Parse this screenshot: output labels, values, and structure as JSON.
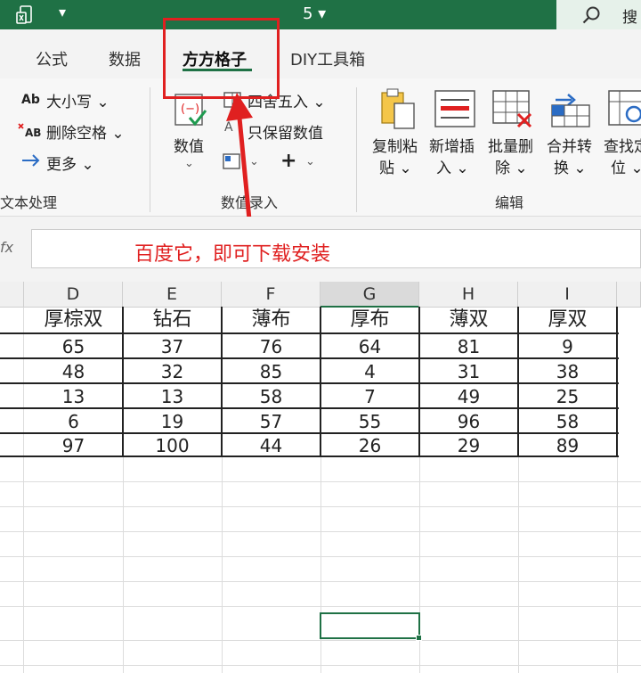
{
  "titlebar": {
    "title": "5 ▾",
    "quick_access_caret": "▾",
    "search_text": "搜"
  },
  "tabs": [
    "公式",
    "数据",
    "方方格子",
    "DIY工具箱"
  ],
  "active_tab": "方方格子",
  "ribbon": {
    "text_group": {
      "case_label": "大小写",
      "case_caret": "⌄",
      "remove_space_label": "删除空格",
      "remove_space_caret": "⌄",
      "more_label": "更多",
      "more_caret": "⌄",
      "group_label": "文本处理"
    },
    "number_group": {
      "value_label": "数值",
      "value_caret": "⌄",
      "round_label": "四舍五入",
      "round_caret": "⌄",
      "keep_value_label": "只保留数值",
      "plus_symbol": "+",
      "plus_caret": "⌄",
      "small_caret": "⌄",
      "group_label": "数值录入"
    },
    "edit_group": {
      "items": [
        {
          "line1": "复制粘",
          "line2": "贴 ⌄"
        },
        {
          "line1": "新增插",
          "line2": "入 ⌄"
        },
        {
          "line1": "批量删",
          "line2": "除 ⌄"
        },
        {
          "line1": "合并转",
          "line2": "换 ⌄"
        },
        {
          "line1": "查找定",
          "line2": "位 ⌄"
        }
      ],
      "group_label": "编辑"
    },
    "accent_color": "#1f7145",
    "highlight_color": "#e02020"
  },
  "formula_bar": {
    "fx_label": "fx",
    "content": "百度它，即可下载安装"
  },
  "sheet": {
    "columns": [
      "D",
      "E",
      "F",
      "G",
      "H",
      "I"
    ],
    "selected_column": "G",
    "header_row": [
      "厚棕双",
      "钻石",
      "薄布",
      "厚布",
      "薄双",
      "厚双"
    ],
    "rows": [
      [
        "65",
        "37",
        "76",
        "64",
        "81",
        "9"
      ],
      [
        "48",
        "32",
        "85",
        "4",
        "31",
        "38"
      ],
      [
        "13",
        "13",
        "58",
        "7",
        "49",
        "25"
      ],
      [
        "6",
        "19",
        "57",
        "55",
        "96",
        "58"
      ],
      [
        "97",
        "100",
        "44",
        "26",
        "29",
        "89"
      ]
    ]
  }
}
